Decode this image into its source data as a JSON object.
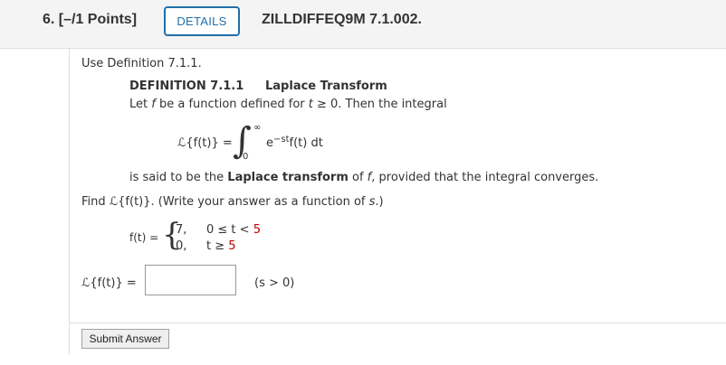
{
  "question": {
    "number_label": "6.  [–/1 Points]",
    "details_label": "DETAILS",
    "code": "ZILLDIFFEQ9M 7.1.002."
  },
  "body": {
    "intro": "Use Definition 7.1.1.",
    "definition_title": "DEFINITION 7.1.1",
    "definition_name": "Laplace Transform",
    "def_line": {
      "before_f": "Let ",
      "f": "f",
      "middle": " be a function defined for ",
      "t": "t",
      "end": " ≥ 0. Then the integral"
    },
    "formula": {
      "lhs": "ℒ{f(t)} =",
      "upper": "∞",
      "lower": "0",
      "integral": "∫",
      "e": "e",
      "exponent": "−st",
      "integrand": "f(t) dt"
    },
    "conclusion": {
      "before": "is said to be the ",
      "bold": "Laplace transform",
      "middle": " of ",
      "f": "f",
      "end": ", provided that the integral converges."
    },
    "task": {
      "before": "Find ",
      "expr": "ℒ{f(t)}",
      "after": ". (Write your answer as a function of ",
      "s": "s",
      "close": ".)"
    },
    "piecewise": {
      "lhs": "f(t) =",
      "brace": "{",
      "rows": [
        {
          "value": "7,",
          "cond_left": "0 ≤ t < ",
          "cond_right": "5"
        },
        {
          "value": "0,",
          "cond_left": "t ≥ ",
          "cond_right": "5"
        }
      ]
    },
    "answer_label": "ℒ{f(t)} =",
    "answer_value": "",
    "condition": "(s > 0)"
  },
  "submit_label": "Submit Answer",
  "colors": {
    "accent": "#1f6fa8",
    "red": "#c00000",
    "header_bg": "#f4f4f4"
  }
}
